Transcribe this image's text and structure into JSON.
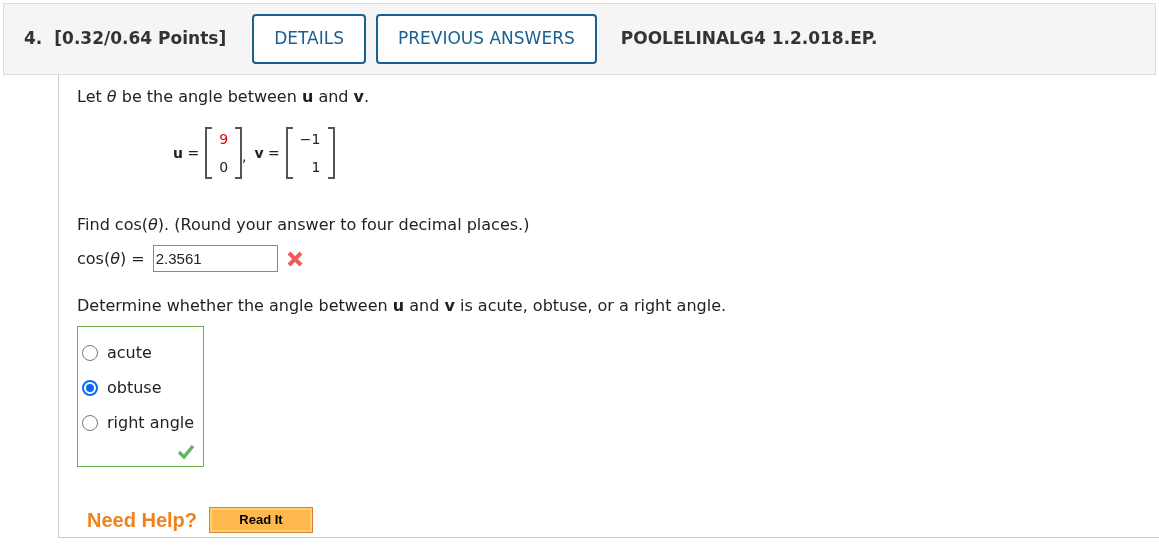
{
  "header": {
    "number": "4.",
    "points": "[0.32/0.64 Points]",
    "buttons": [
      "DETAILS",
      "PREVIOUS ANSWERS"
    ],
    "code": "POOLELINALG4 1.2.018.EP."
  },
  "question": {
    "intro": "Let *θ* be the angle between **u** and **v**.",
    "vectors": [
      {
        "label": "**u** =",
        "entries": [
          {
            "value": "9",
            "color": "#e0000f"
          },
          {
            "value": "0",
            "color": "#222222"
          }
        ]
      },
      {
        "label": "**v** =",
        "entries": [
          {
            "value": "−1",
            "color": "#222222"
          },
          {
            "value": "1",
            "color": "#222222"
          }
        ]
      }
    ],
    "separator": ",",
    "part1_prompt": "Find cos(*θ*). (Round your answer to four decimal places.)",
    "answer_label": "cos(*θ*) =",
    "answer_value": "2.3561",
    "answer_correct": false,
    "part2_prompt": "Determine whether the angle between **u** and **v** is acute, obtuse, or a right angle.",
    "options": [
      {
        "label": "acute",
        "selected": false
      },
      {
        "label": "obtuse",
        "selected": true
      },
      {
        "label": "right angle",
        "selected": false
      }
    ],
    "options_correct": true
  },
  "help": {
    "label": "Need Help?",
    "buttons": [
      "Read It"
    ]
  }
}
